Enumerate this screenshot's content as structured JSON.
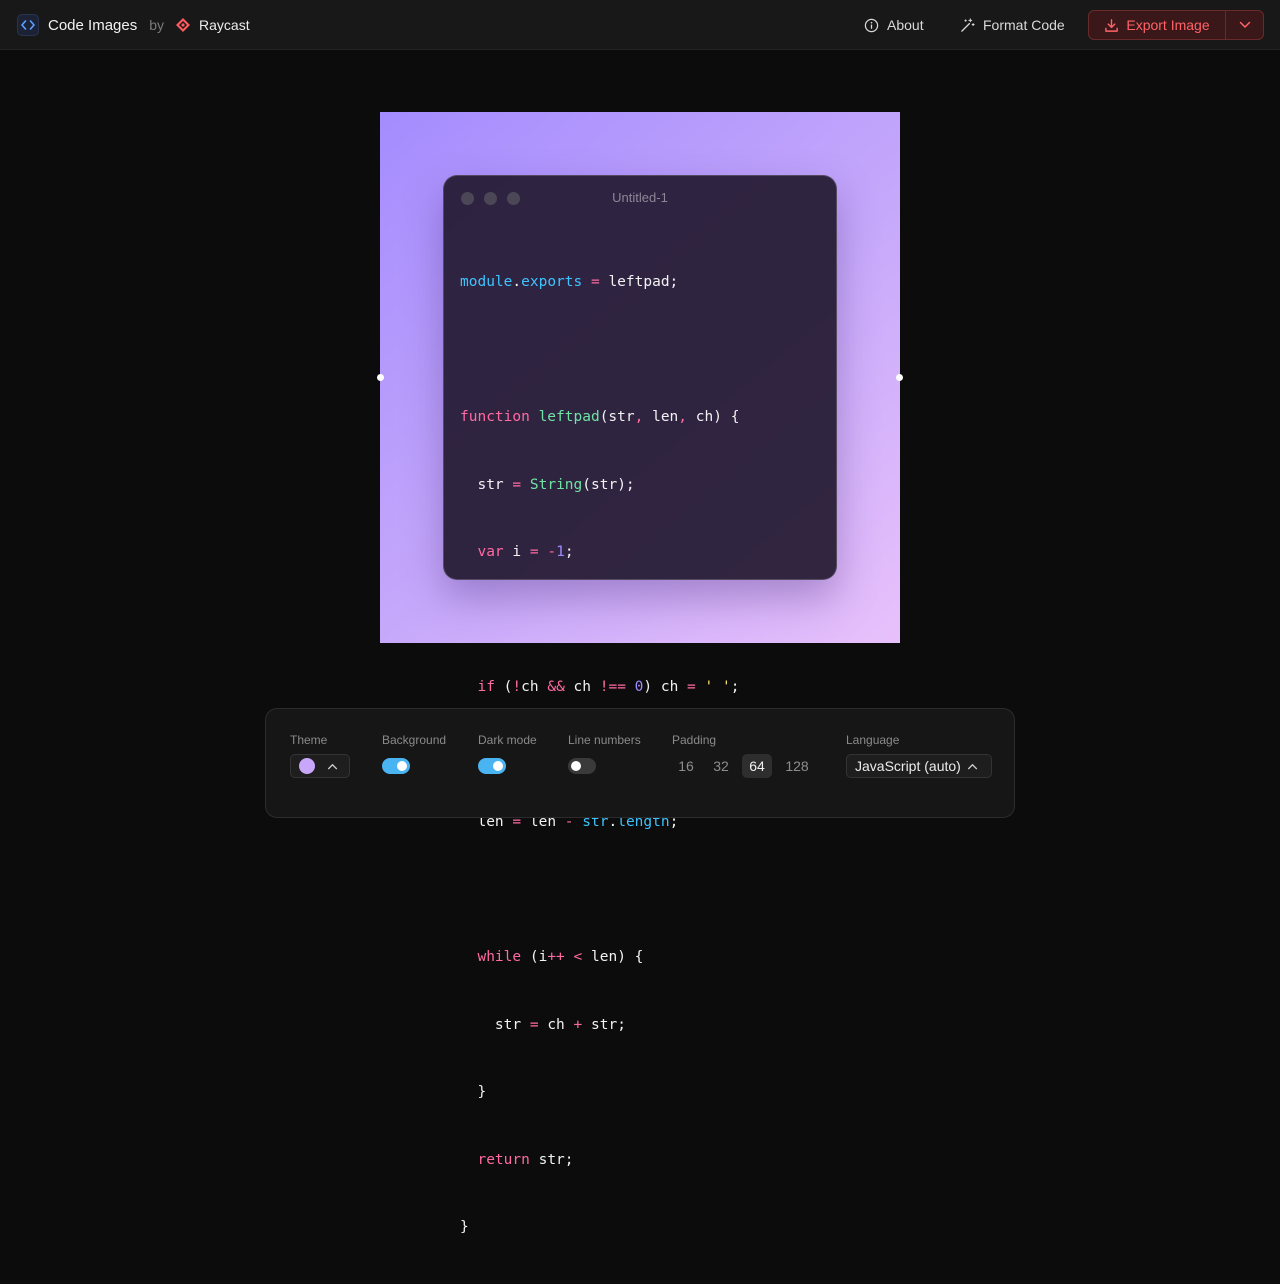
{
  "header": {
    "app_title": "Code Images",
    "by": "by",
    "partner": "Raycast",
    "about": "About",
    "format_code": "Format Code",
    "export_image": "Export Image"
  },
  "editor": {
    "window_title": "Untitled-1",
    "background_gradient": [
      "#a48cfe",
      "#c3a6fb",
      "#e8c1fb"
    ]
  },
  "code": {
    "line_1": [
      "module",
      ".",
      "exports",
      " = ",
      "leftpad",
      ";"
    ],
    "line_3": [
      "function",
      " ",
      "leftpad",
      "(",
      "str",
      ", ",
      "len",
      ", ",
      "ch",
      ") {"
    ],
    "line_4": [
      "  ",
      "str",
      " = ",
      "String",
      "(",
      "str",
      ");"
    ],
    "line_5": [
      "  ",
      "var",
      " ",
      "i",
      " = ",
      "-",
      "1",
      ";"
    ],
    "line_7": [
      "  ",
      "if",
      " (",
      "!",
      "ch",
      " && ",
      "ch",
      " !== ",
      "0",
      ") ",
      "ch",
      " = ",
      "' '",
      ";"
    ],
    "line_9": [
      "  ",
      "len",
      " = ",
      "len",
      " - ",
      "str",
      ".",
      "length",
      ";"
    ],
    "line_11": [
      "  ",
      "while",
      " (",
      "i",
      "++",
      " < ",
      "len",
      ") {"
    ],
    "line_12": [
      "    ",
      "str",
      " = ",
      "ch",
      " + ",
      "str",
      ";"
    ],
    "line_13": [
      "  }"
    ],
    "line_14": [
      "  ",
      "return",
      " ",
      "str",
      ";"
    ],
    "line_15": [
      "}"
    ]
  },
  "controls": {
    "theme_label": "Theme",
    "theme_color": "#c8a6fa",
    "background_label": "Background",
    "background_on": true,
    "dark_mode_label": "Dark mode",
    "dark_mode_on": true,
    "line_numbers_label": "Line numbers",
    "line_numbers_on": false,
    "padding_label": "Padding",
    "padding_options": [
      "16",
      "32",
      "64",
      "128"
    ],
    "padding_selected": "64",
    "language_label": "Language",
    "language_value": "JavaScript (auto)"
  },
  "colors": {
    "accent_export": "#ff6368",
    "toggle_on": "#4ab4f2",
    "keyword": "#ff6aa1",
    "property": "#3ec3ff",
    "function": "#6fe3a3",
    "number": "#9d8cff",
    "string": "#ffe566"
  }
}
